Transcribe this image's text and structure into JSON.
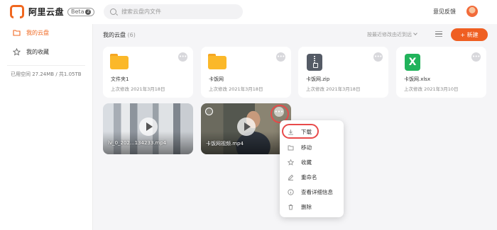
{
  "app": {
    "logo_text": "阿里云盘",
    "beta_label": "Beta",
    "beta_badge": "2"
  },
  "search": {
    "placeholder": "搜索云盘内文件"
  },
  "header": {
    "feedback_label": "意见反馈"
  },
  "sidebar": {
    "items": [
      {
        "label": "我的云盘",
        "icon": "folder-icon",
        "active": true
      },
      {
        "label": "我的收藏",
        "icon": "star-icon",
        "active": false
      }
    ],
    "usage_text": "已用空间 27.24MB / 共1.05TB"
  },
  "main": {
    "breadcrumb": "我的云盘",
    "item_count": "(6)",
    "sort_label": "按最近修改由近到远",
    "new_button_label": "+ 新建",
    "files": [
      {
        "name": "文件夹1",
        "modified": "上次修改 2021年3月18日",
        "icon": "folder-icon"
      },
      {
        "name": "卡饭网",
        "modified": "上次修改 2021年3月18日",
        "icon": "folder-icon"
      },
      {
        "name": "卡饭网.zip",
        "modified": "上次修改 2021年3月18日",
        "icon": "zip-icon"
      },
      {
        "name": "卡饭网.xlsx",
        "modified": "上次修改 2021年3月10日",
        "icon": "excel-icon",
        "icon_letter": "X"
      }
    ],
    "videos": [
      {
        "name": "lv_0_202...134233.mp4"
      },
      {
        "name": "卡饭网视频.mp4"
      }
    ],
    "more_glyph": "•••"
  },
  "context_menu": {
    "items": [
      {
        "label": "下载",
        "icon": "download-icon"
      },
      {
        "label": "移动",
        "icon": "move-icon"
      },
      {
        "label": "收藏",
        "icon": "star-icon"
      },
      {
        "label": "重命名",
        "icon": "rename-icon"
      },
      {
        "label": "查看详细信息",
        "icon": "info-icon"
      },
      {
        "label": "删除",
        "icon": "delete-icon"
      }
    ]
  },
  "colors": {
    "accent": "#ef5f22",
    "highlight": "#e84a4a",
    "folder": "#fbb829",
    "excel": "#21b35b"
  }
}
